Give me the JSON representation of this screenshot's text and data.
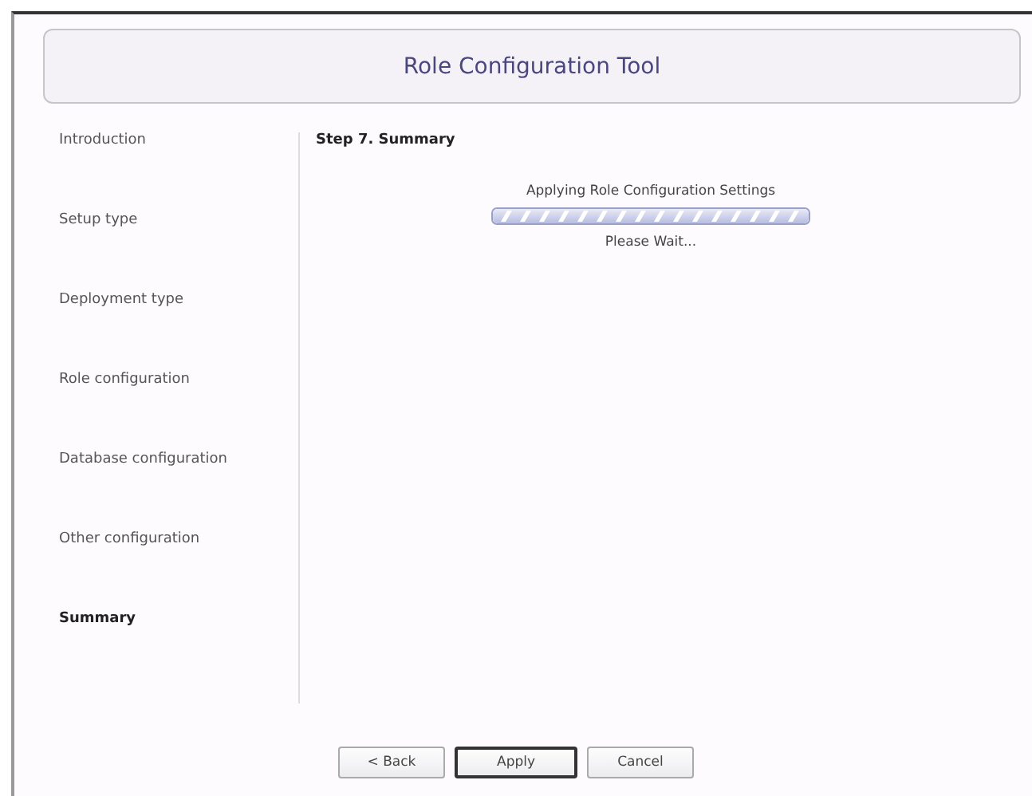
{
  "window": {
    "title": "Role Configuration Tool"
  },
  "steps": [
    {
      "label": "Introduction",
      "selected": false
    },
    {
      "label": "Setup type",
      "selected": false
    },
    {
      "label": "Deployment type",
      "selected": false
    },
    {
      "label": "Role configuration",
      "selected": false
    },
    {
      "label": "Database configuration",
      "selected": false
    },
    {
      "label": "Other configuration",
      "selected": false
    },
    {
      "label": "Summary",
      "selected": true
    }
  ],
  "content": {
    "heading": "Step 7. Summary",
    "status": "Applying Role Configuration Settings",
    "message": "Please Wait...",
    "progress": {
      "level": 1
    }
  },
  "buttons": [
    {
      "label": "< Back",
      "default": false
    },
    {
      "label": "Apply",
      "default": true
    },
    {
      "label": "Cancel",
      "default": false
    }
  ]
}
